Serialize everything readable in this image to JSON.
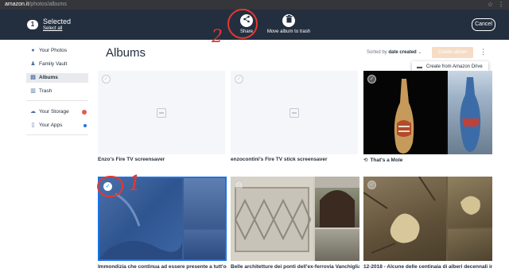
{
  "browser": {
    "host": "amazon.it",
    "path": "/photos/albums"
  },
  "selection": {
    "count": "1",
    "title": "Selected",
    "select_all": "Select all",
    "share_label": "Share",
    "trash_label": "Move album to trash",
    "cancel_label": "Cancel"
  },
  "annotations": {
    "one": "1",
    "two": "2"
  },
  "sidebar": {
    "items": [
      {
        "label": "Your Photos",
        "icon": "person-icon"
      },
      {
        "label": "Family Vault",
        "icon": "family-icon"
      },
      {
        "label": "Albums",
        "icon": "albums-icon"
      },
      {
        "label": "Trash",
        "icon": "trash-icon"
      },
      {
        "label": "Your Storage",
        "icon": "cloud-icon",
        "dot_color": "#e05a5a"
      },
      {
        "label": "Your Apps",
        "icon": "phone-icon",
        "dot_color": "#1a73e8"
      }
    ]
  },
  "main": {
    "title": "Albums",
    "sort_prefix": "Sorted by",
    "sort_value": "date created",
    "create_label": "Create album",
    "dropdown_label": "Create from Amazon Drive"
  },
  "albums": [
    {
      "name": "Enzo's Fire TV screensaver",
      "selected": false
    },
    {
      "name": "enzocontini's Fire TV stick screensaver",
      "selected": false
    },
    {
      "name": "That's a Mole",
      "selected": false
    },
    {
      "name": "Immondizia che continua ad essere presente a tutt'og...",
      "selected": true
    },
    {
      "name": "Belle architetture dei ponti dell'ex-ferrovia Vanchiglia",
      "selected": false
    },
    {
      "name": "12-2018 - Alcune delle centinaia di alberi decennali in...",
      "selected": false
    }
  ],
  "colors": {
    "header_bg": "#232f3e",
    "accent": "#1a73e8",
    "annotation": "#e8372f",
    "create_btn": "#f6dcc4"
  }
}
